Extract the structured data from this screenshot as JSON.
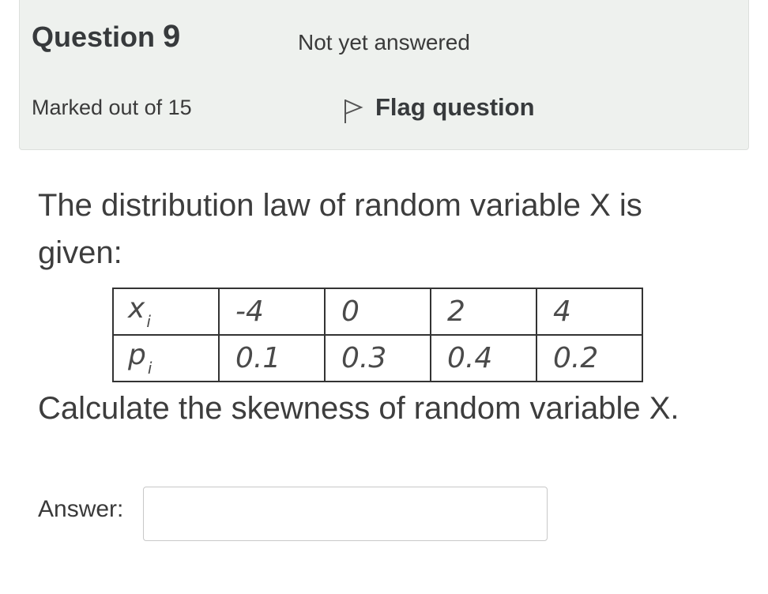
{
  "info": {
    "question_word": "Question",
    "question_number": "9",
    "state": "Not yet answered",
    "marks": "Marked out of 15",
    "flag_label": "Flag question",
    "flag_icon": "flag-outline-icon"
  },
  "question": {
    "text": "The distribution law of random variable X is given:",
    "prompt": "Calculate the skewness of random variable X.",
    "table": {
      "x_label": "x",
      "x_sub": "i",
      "p_label": "p",
      "p_sub": "i",
      "x_values": [
        "-4",
        "0",
        "2",
        "4"
      ],
      "p_values": [
        "0.1",
        "0.3",
        "0.4",
        "0.2"
      ]
    }
  },
  "answer": {
    "label": "Answer:",
    "value": "",
    "placeholder": ""
  }
}
